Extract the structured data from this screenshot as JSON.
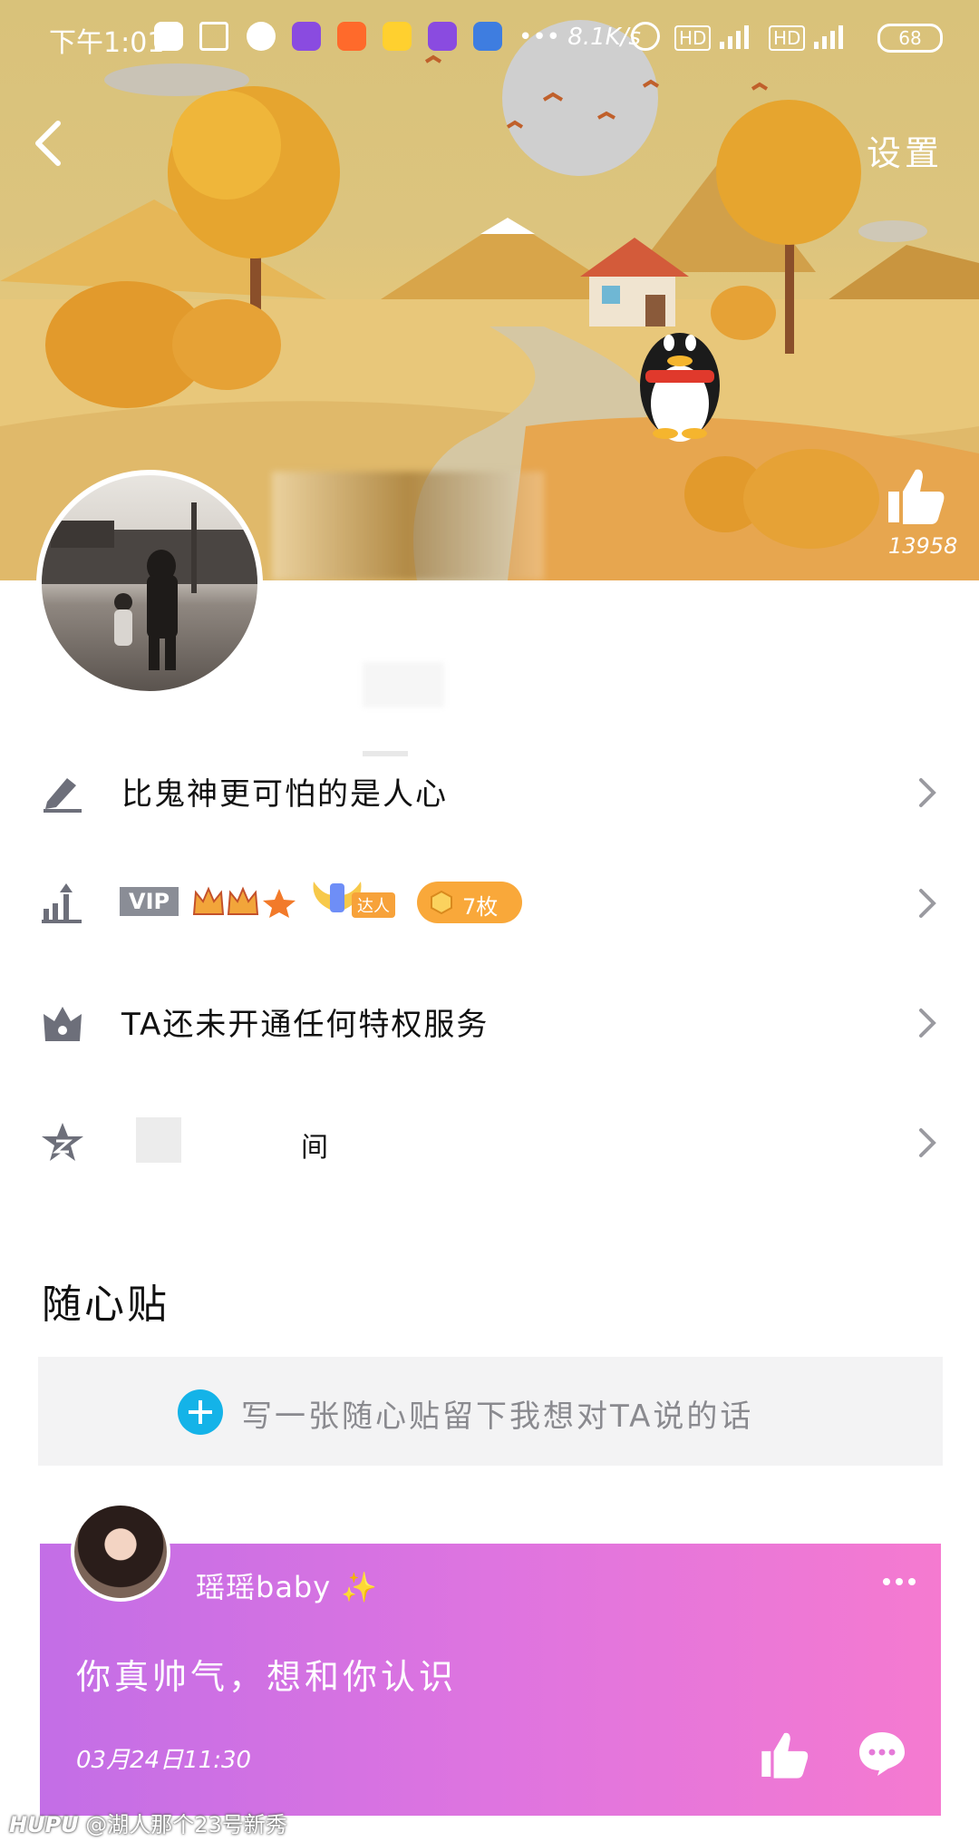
{
  "status_bar": {
    "time": "下午1:01",
    "network_speed": "••• 8.1K/s",
    "hd1": "HD",
    "hd2": "HD",
    "battery": "68"
  },
  "header": {
    "back_icon": "chevron-left-icon",
    "settings_label": "设置"
  },
  "profile": {
    "like_count": "13958"
  },
  "info_rows": [
    {
      "icon": "pencil-icon",
      "label": "比鬼神更可怕的是人心"
    },
    {
      "icon": "level-up-icon",
      "vip": "VIP",
      "badge_count": "7枚",
      "expert": "达人"
    },
    {
      "icon": "crown-icon",
      "label": "TA还未开通任何特权服务"
    },
    {
      "icon": "qzone-star-icon",
      "label": "间"
    }
  ],
  "sticky_notes": {
    "title": "随心贴",
    "write_prompt": "写一张随心贴留下我想对TA说的话",
    "note": {
      "username": "瑶瑶baby",
      "message": "你真帅气，想和你认识",
      "time": "03月24日11:30"
    }
  },
  "watermark": {
    "brand": "HUPU",
    "text": "@湖人那个23号新秀"
  },
  "colors": {
    "accent_blue": "#14b3e8",
    "badge_orange": "#f9a83a",
    "card_gradient_start": "#c36ee6",
    "card_gradient_end": "#f57ad0"
  }
}
